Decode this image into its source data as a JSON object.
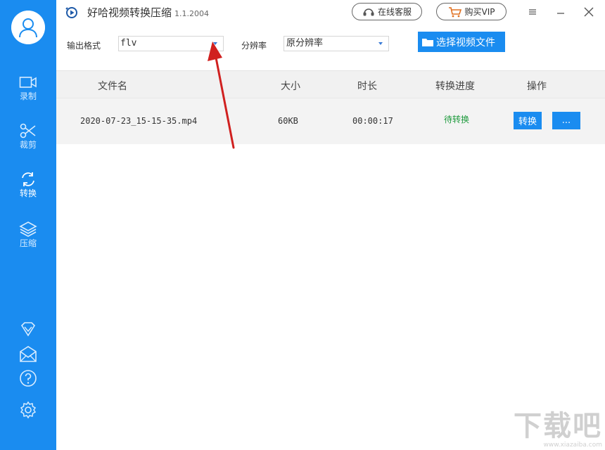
{
  "app": {
    "title": "好哈视频转换压缩",
    "version": "1.1.2004",
    "support_label": "在线客服",
    "vip_label": "购买VIP"
  },
  "sidebar": {
    "items": [
      {
        "label": "录制",
        "icon": "video-camera-icon"
      },
      {
        "label": "裁剪",
        "icon": "scissors-icon"
      },
      {
        "label": "转换",
        "icon": "convert-cycle-icon",
        "active": true
      },
      {
        "label": "压缩",
        "icon": "layers-icon"
      }
    ],
    "bottom_icons": [
      "diamond-icon",
      "mail-icon",
      "help-icon",
      "settings-icon"
    ]
  },
  "toolbar": {
    "format_label": "输出格式",
    "format_value": "flv",
    "resolution_label": "分辨率",
    "resolution_value": "原分辨率",
    "choose_file_label": "选择视频文件"
  },
  "table": {
    "columns": [
      "文件名",
      "大小",
      "时长",
      "转换进度",
      "操作"
    ],
    "rows": [
      {
        "filename": "2020-07-23_15-15-35.mp4",
        "size": "60KB",
        "duration": "00:00:17",
        "status": "待转换",
        "convert_label": "转换",
        "more_label": "..."
      }
    ]
  },
  "watermark": {
    "text": "下载吧",
    "url": "www.xiazaiba.com"
  },
  "colors": {
    "brand_blue": "#1a8cf0",
    "status_green": "#1d9a3c",
    "annotation_red": "#d0201f"
  }
}
